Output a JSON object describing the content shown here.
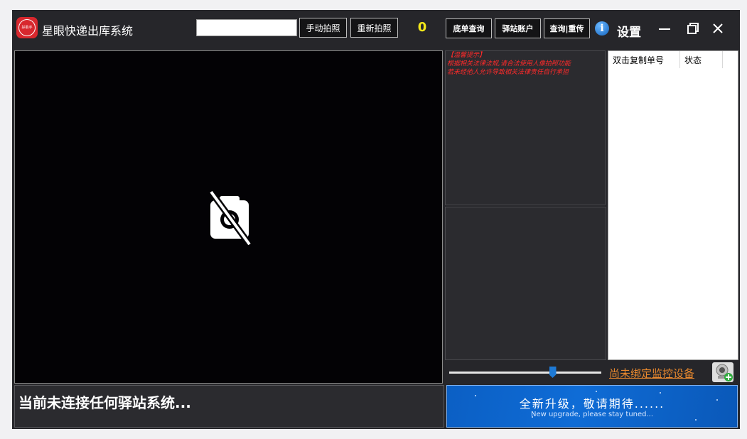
{
  "app": {
    "logo_text": "好助手",
    "title": "星眼快递出库系统"
  },
  "toolbar": {
    "input_value": "",
    "manual_photo_label": "手动拍照",
    "retake_label": "重新拍照",
    "count": "0",
    "bottom_query_label": "底单查询",
    "station_account_label": "驿站账户",
    "query_resend_label": "查询|重传",
    "settings_label": "设置"
  },
  "camera": {
    "status_icon": "camera-off-icon"
  },
  "notice": {
    "lines": [
      "【温馨提示】",
      "根据相关法律法规,请合法使用人像拍照功能",
      "若未经他人允许导致相关法律责任自行承担"
    ]
  },
  "list": {
    "columns": [
      "双击复制单号",
      "状态"
    ],
    "rows": []
  },
  "slider": {
    "value_fraction": 0.68
  },
  "monitor": {
    "bind_link": "尚未绑定监控设备"
  },
  "status": {
    "text": "当前未连接任何驿站系统..."
  },
  "banner": {
    "title": "全新升级，敬请期待......",
    "subtitle": "New upgrade, please stay tuned..."
  },
  "colors": {
    "accent_count": "#f4e81a",
    "link": "#e8882e",
    "notice": "#ff2a2a",
    "banner_blue": "#0f6cd6"
  }
}
